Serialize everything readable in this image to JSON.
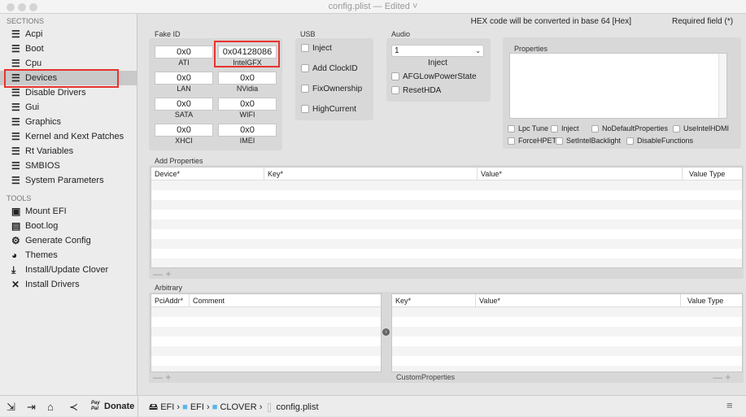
{
  "window": {
    "title": "config.plist — Edited ˅"
  },
  "sidebar": {
    "sections_header": "SECTIONS",
    "sections": [
      "Acpi",
      "Boot",
      "Cpu",
      "Devices",
      "Disable Drivers",
      "Gui",
      "Graphics",
      "Kernel and Kext Patches",
      "Rt Variables",
      "SMBIOS",
      "System Parameters"
    ],
    "selected": "Devices",
    "tools_header": "TOOLS",
    "tools": [
      {
        "label": "Mount EFI",
        "icon": "drive-icon"
      },
      {
        "label": "Boot.log",
        "icon": "log-icon"
      },
      {
        "label": "Generate Config",
        "icon": "gear-icon"
      },
      {
        "label": "Themes",
        "icon": "palette-icon"
      },
      {
        "label": "Install/Update Clover",
        "icon": "download-icon"
      },
      {
        "label": "Install Drivers",
        "icon": "tools-icon"
      }
    ]
  },
  "header": {
    "hex_note": "HEX code will be converted in base 64 [Hex]",
    "required_note": "Required field (*)"
  },
  "fake_id": {
    "label": "Fake ID",
    "fields": [
      {
        "label": "ATI",
        "value": "0x0"
      },
      {
        "label": "IntelGFX",
        "value": "0x04128086"
      },
      {
        "label": "LAN",
        "value": "0x0"
      },
      {
        "label": "NVidia",
        "value": "0x0"
      },
      {
        "label": "SATA",
        "value": "0x0"
      },
      {
        "label": "WIFI",
        "value": "0x0"
      },
      {
        "label": "XHCI",
        "value": "0x0"
      },
      {
        "label": "IMEI",
        "value": "0x0"
      }
    ]
  },
  "usb": {
    "label": "USB",
    "options": [
      "Inject",
      "Add ClockID",
      "FixOwnership",
      "HighCurrent"
    ]
  },
  "audio": {
    "label": "Audio",
    "inject_value": "1",
    "inject_label": "Inject",
    "options": [
      "AFGLowPowerState",
      "ResetHDA"
    ]
  },
  "properties": {
    "label": "Properties",
    "options": [
      "Lpc Tune",
      "Inject",
      "NoDefaultProperties",
      "UseIntelHDMI",
      "ForceHPET",
      "SetIntelBacklight",
      "DisableFunctions"
    ]
  },
  "add_properties": {
    "label": "Add Properties",
    "columns": [
      "Device*",
      "Key*",
      "Value*",
      "Value Type"
    ]
  },
  "arbitrary": {
    "label": "Arbitrary",
    "left_columns": [
      "PciAddr*",
      "Comment"
    ],
    "right_columns": [
      "Key*",
      "Value*",
      "Value Type"
    ],
    "right_footer": "CustomProperties"
  },
  "controls": {
    "remove": "—",
    "add": "+"
  },
  "bottom": {
    "donate": "Donate",
    "paypal": "Pay Pal",
    "path": [
      "EFI",
      "EFI",
      "CLOVER",
      "config.plist"
    ]
  }
}
